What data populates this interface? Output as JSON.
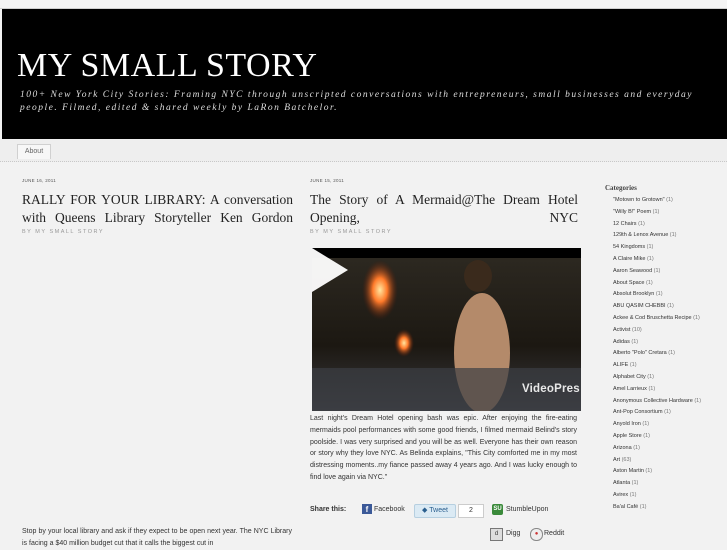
{
  "site": {
    "title": "MY SMALL STORY",
    "tagline": "100+ New York City Stories: Framing NYC through unscripted conversations with entrepreneurs, small businesses and everyday people. Filmed, edited & shared weekly by LaRon Batchelor."
  },
  "nav": {
    "about": "About"
  },
  "post1": {
    "date": "JUNE 16, 2011",
    "title_line1": "RALLY FOR YOUR LIBRARY: A conversation",
    "title_line2": "with Queens Library Storyteller Ken Gordon",
    "byline": "BY MY SMALL STORY",
    "body": "Stop by your local library and ask if they expect to be open next year. The NYC Library is facing a $40 million budget cut that it calls the biggest cut in"
  },
  "post2": {
    "date": "JUNE 15, 2011",
    "title_line1": "The Story of A Mermaid@The Dream Hotel",
    "title_line2": "Opening, NYC",
    "byline": "BY MY SMALL STORY",
    "video_brand": "VideoPres",
    "body": "Last night's Dream Hotel opening bash was epic. After enjoying the fire-eating mermaids pool performances with some good friends, I filmed mermaid Belind's story poolside. I was very surprised and you will be as well. Everyone has their own reason or story why they love NYC. As Belinda explains, \"This City comforted me in my most distressing moments..my fiance passed away 4 years ago. And I was lucky enough to find love again via NYC.\"",
    "share": {
      "label": "Share this:",
      "facebook": "Facebook",
      "tweet": "Tweet",
      "tweet_count": "2",
      "stumbleupon": "StumbleUpon",
      "digg": "Digg",
      "reddit": "Reddit"
    }
  },
  "sidebar": {
    "heading": "Categories",
    "categories": [
      {
        "name": "\"Motown to Grotown\"",
        "count": "(1)"
      },
      {
        "name": "\"Willy B!\" Poem",
        "count": "(1)"
      },
      {
        "name": "12 Chairs",
        "count": "(1)"
      },
      {
        "name": "129th & Lenox Avenue",
        "count": "(1)"
      },
      {
        "name": "54 Kingdoms",
        "count": "(1)"
      },
      {
        "name": "A Claire Mike",
        "count": "(1)"
      },
      {
        "name": "Aaron Seawood",
        "count": "(1)"
      },
      {
        "name": "About Space",
        "count": "(1)"
      },
      {
        "name": "Absolut Brooklyn",
        "count": "(1)"
      },
      {
        "name": "ABU QASIM CHEBBI",
        "count": "(1)"
      },
      {
        "name": "Ackee & Cod Bruschetta Recipe",
        "count": "(1)"
      },
      {
        "name": "Activist",
        "count": "(10)"
      },
      {
        "name": "Adidas",
        "count": "(1)"
      },
      {
        "name": "Alberto \"Polo\" Cretara",
        "count": "(1)"
      },
      {
        "name": "ALIFE",
        "count": "(1)"
      },
      {
        "name": "Alphabet City",
        "count": "(1)"
      },
      {
        "name": "Amel Larrieux",
        "count": "(1)"
      },
      {
        "name": "Anonymous Collective Hardware",
        "count": "(1)"
      },
      {
        "name": "Ant-Pop Consortium",
        "count": "(1)"
      },
      {
        "name": "Anyold Iron",
        "count": "(1)"
      },
      {
        "name": "Apple Store",
        "count": "(1)"
      },
      {
        "name": "Arizona",
        "count": "(1)"
      },
      {
        "name": "Art",
        "count": "(63)"
      },
      {
        "name": "Aston Martin",
        "count": "(1)"
      },
      {
        "name": "Atlanta",
        "count": "(1)"
      },
      {
        "name": "Avirex",
        "count": "(1)"
      },
      {
        "name": "Ba'al Café",
        "count": "(1)"
      }
    ]
  }
}
